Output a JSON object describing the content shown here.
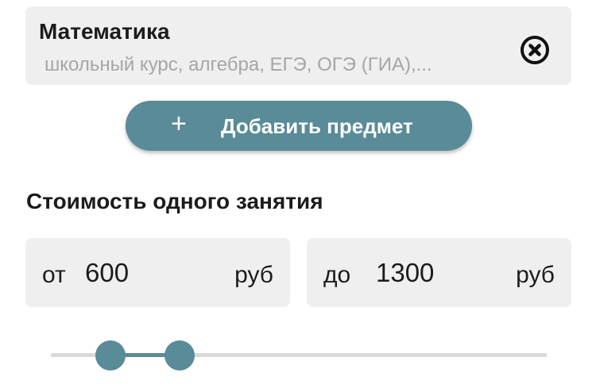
{
  "subject": {
    "title": "Математика",
    "description": "школьный курс, алгебра, ЕГЭ, ОГЭ (ГИА),..."
  },
  "add_subject": {
    "plus": "+",
    "label": "Добавить предмет"
  },
  "price": {
    "section_title": "Стоимость одного занятия",
    "from": {
      "prefix": "от",
      "value": "600",
      "unit": "руб"
    },
    "to": {
      "prefix": "до",
      "value": "1300",
      "unit": "руб"
    }
  },
  "slider": {
    "lower_fraction": 0.12,
    "upper_fraction": 0.259
  },
  "colors": {
    "accent": "#598b98",
    "field_bg": "#efefef",
    "text": "#1c1c1c",
    "muted_text": "#a6a6a6"
  },
  "icons": {
    "remove": "close-circle-icon",
    "add": "plus-icon"
  }
}
